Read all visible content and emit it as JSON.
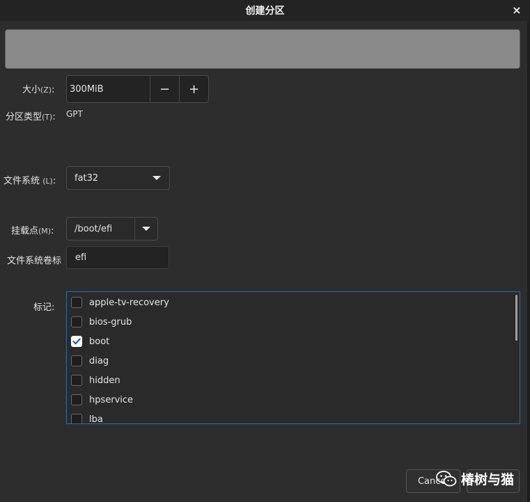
{
  "window": {
    "title": "创建分区",
    "close_glyph": "×"
  },
  "size": {
    "label": "大小",
    "mnemonic": "(Z)",
    "suffix": ":",
    "value": "300MiB",
    "minus": "−",
    "plus": "+"
  },
  "partition_type": {
    "label": "分区类型",
    "mnemonic": "(T)",
    "suffix": ":",
    "value": "GPT"
  },
  "filesystem": {
    "label": "文件系统 ",
    "mnemonic": "(L)",
    "suffix": ":",
    "value": "fat32"
  },
  "mount_point": {
    "label": "挂载点",
    "mnemonic": "(M)",
    "suffix": ":",
    "value": "/boot/efi"
  },
  "fs_label": {
    "label": "文件系统卷标",
    "value": "efi"
  },
  "flags": {
    "label": "标记:",
    "items": [
      {
        "label": "apple-tv-recovery",
        "checked": false
      },
      {
        "label": "bios-grub",
        "checked": false
      },
      {
        "label": "boot",
        "checked": true
      },
      {
        "label": "diag",
        "checked": false
      },
      {
        "label": "hidden",
        "checked": false
      },
      {
        "label": "hpservice",
        "checked": false
      },
      {
        "label": "lba",
        "checked": false
      }
    ]
  },
  "buttons": {
    "cancel": "Cancel",
    "ok": ""
  },
  "watermark": {
    "text": "椿树与猫",
    "icon": "wechat-icon"
  },
  "colors": {
    "accent": "#2f6ba8",
    "check": "#1f5fb0"
  }
}
